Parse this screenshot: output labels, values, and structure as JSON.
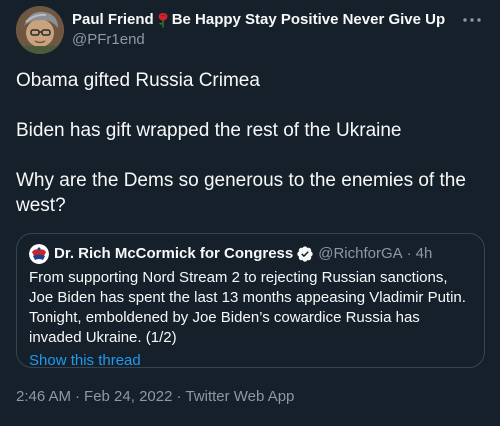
{
  "author": {
    "display_name_part1": "Paul Friend",
    "display_name_part2": "Be Happy Stay Positive Never Give Up",
    "rose_emoji": "rose-icon",
    "handle": "@PFr1end"
  },
  "tweet": {
    "paragraphs": [
      "Obama gifted Russia Crimea",
      "Biden has gift wrapped the rest of the Ukraine",
      "Why are the Dems so generous to the enemies of the west?"
    ]
  },
  "quoted_tweet": {
    "display_name": "Dr. Rich McCormick for Congress",
    "handle": "@RichforGA",
    "separator": "·",
    "time": "4h",
    "text": "From supporting Nord Stream 2 to rejecting Russian sanctions, Joe Biden has spent the last 13 months appeasing Vladimir Putin.  Tonight, emboldened by Joe Biden’s cowardice Russia has invaded Ukraine. (1/2)",
    "show_thread": "Show this thread"
  },
  "meta": {
    "time": "2:46 AM",
    "dot1": "·",
    "date": "Feb 24, 2022",
    "dot2": "·",
    "source": "Twitter Web App"
  },
  "colors": {
    "background": "#15202b",
    "text": "#f7f9f9",
    "secondary": "#8b98a5",
    "link": "#1d9bf0",
    "border": "#38444d",
    "verified": "#1d9bf0"
  }
}
